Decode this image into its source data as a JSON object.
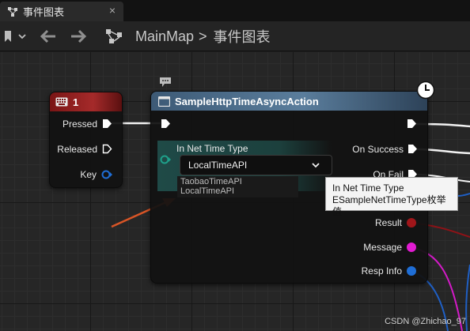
{
  "tab": {
    "title": "事件图表",
    "close": "×"
  },
  "toolbar": {
    "breadcrumb": {
      "root": "MainMap",
      "separator": ">",
      "current": "事件图表"
    }
  },
  "key_node": {
    "title": "1",
    "pins": {
      "pressed": "Pressed",
      "released": "Released",
      "key": "Key"
    }
  },
  "action_node": {
    "title": "SampleHttpTimeAsyncAction",
    "param_label": "In Net Time Type",
    "selected_value": "LocalTimeAPI",
    "outputs": {
      "on_success": "On Success",
      "on_fail": "On Fail",
      "result": "Result",
      "message": "Message",
      "resp_info": "Resp Info"
    }
  },
  "dropdown": {
    "options": [
      "TaobaoTimeAPI",
      "LocalTimeAPI"
    ]
  },
  "tooltip": {
    "line1": "In Net Time Type",
    "line2": "ESampleNetTimeType枚举值"
  },
  "watermark": "CSDN @Zhichao_97",
  "colors": {
    "key_header": "#8a1a1a",
    "action_header": "#4a6a86",
    "param_bg": "#1f4a47",
    "exec": "#ffffff",
    "struct_pin": "#1f6ed6",
    "result_pin": "#a0161a",
    "message_pin": "#e21bd2",
    "arrow": "#d95526"
  },
  "icons": [
    "event-graph-icon",
    "bookmark-icon",
    "back-arrow-icon",
    "forward-arrow-icon",
    "graph-breadcrumb-icon",
    "keyboard-icon",
    "function-icon",
    "latent-clock-icon",
    "comment-bubble-icon",
    "chevron-down-icon"
  ]
}
